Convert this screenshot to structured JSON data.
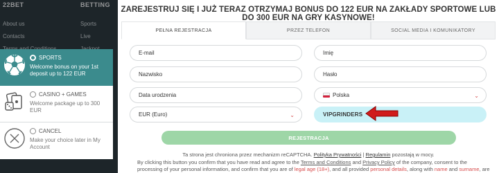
{
  "background_footer": {
    "col1": {
      "heading": "22BET",
      "links": [
        "About us",
        "Contacts",
        "Terms and Conditions"
      ]
    },
    "col2": {
      "heading": "BETTING",
      "links": [
        "Sports",
        "Live",
        "Jackpot"
      ]
    }
  },
  "bonus_options": [
    {
      "title": "SPORTS",
      "description": "Welcome bonus on your 1st deposit up to 122 EUR",
      "icon": "soccer-ball-icon",
      "selected": true
    },
    {
      "title": "CASINO + GAMES",
      "description": "Welcome package up to 300 EUR",
      "icon": "dice-cards-icon",
      "selected": false
    },
    {
      "title": "CANCEL",
      "description": "Make your choice later in My Account",
      "icon": "close-circle-icon",
      "selected": false
    }
  ],
  "modal": {
    "heading": "ZAREJESTRUJ SIĘ I JUŻ TERAZ OTRZYMAJ BONUS DO 122 EUR NA ZAKŁADY SPORTOWE LUB DO 300 EUR NA GRY KASYNOWE!",
    "tabs": [
      "PEŁNA REJESTRACJA",
      "PRZEZ TELEFON",
      "SOCIAL MEDIA I KOMUNIKATORY"
    ],
    "fields": {
      "email": {
        "placeholder": "E-mail"
      },
      "first_name": {
        "placeholder": "Imię"
      },
      "last_name": {
        "placeholder": "Nazwisko"
      },
      "password": {
        "placeholder": "Hasło"
      },
      "birth_date": {
        "placeholder": "Data urodzenia"
      },
      "country": {
        "value": "Polska"
      },
      "currency": {
        "value": "EUR (Euro)"
      },
      "promo_code": {
        "value": "VIPGRINDERS"
      }
    },
    "submit_label": "REJESTRACJA",
    "captcha": {
      "prefix": "Ta strona jest chroniona przez mechanizm reCAPTCHA.",
      "privacy_link": "Polityka Prywatności",
      "separator": "|",
      "rules_link": "Regulamin",
      "suffix": "pozostają w mocy."
    },
    "consent": {
      "t1": "By clicking this button you confirm that you have read and agree to the",
      "terms_link": "Terms and Conditions",
      "t2": "and",
      "privacy_link": "Privacy Policy",
      "t3": "of the company, consent to the processing of your personal information, and confirm that you are of",
      "age": "legal age (18+)",
      "t4": ", and all provided",
      "personal": "personal details",
      "t5": ", along with",
      "name": "name",
      "t6": "and",
      "surname": "surname",
      "t7": ", are valid."
    }
  },
  "colors": {
    "accent_teal": "#3b8b8d",
    "submit_green": "#9ed6a7",
    "promo_bg": "#c9f1f7",
    "alert_red": "#d64b4b"
  }
}
